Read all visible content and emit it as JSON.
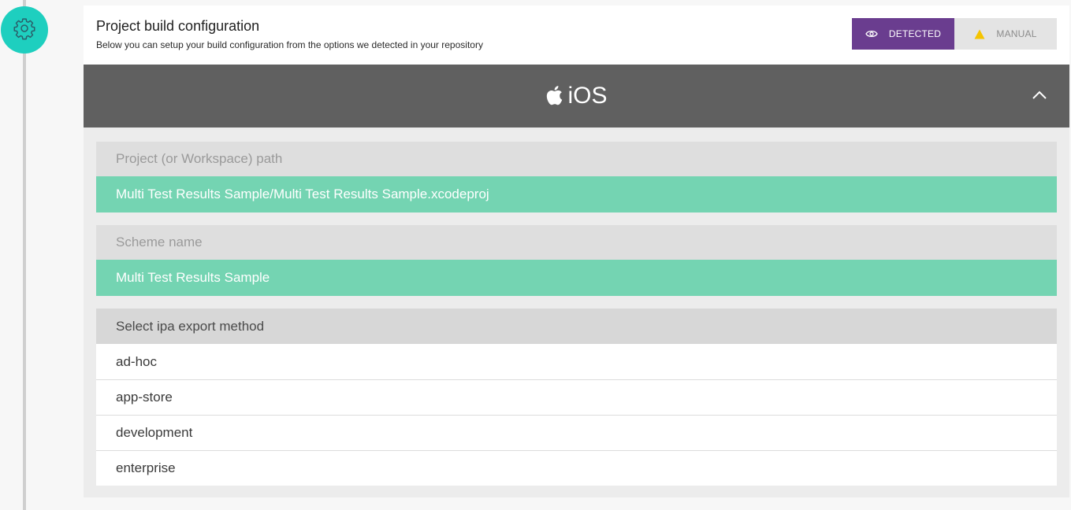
{
  "header": {
    "title": "Project build configuration",
    "subtitle": "Below you can setup your build configuration from the options we detected in your repository"
  },
  "step": {
    "icon": "gear-icon"
  },
  "mode_toggle": {
    "detected_label": "DETECTED",
    "detected_icon": "eye-icon",
    "manual_label": "MANUAL",
    "manual_icon": "warning-icon",
    "active": "DETECTED"
  },
  "platform": {
    "name": "iOS",
    "icon": "apple-icon",
    "collapse_icon": "chevron-up-icon"
  },
  "fields": {
    "project_path": {
      "label": "Project (or Workspace) path",
      "value": "Multi Test Results Sample/Multi Test Results Sample.xcodeproj"
    },
    "scheme": {
      "label": "Scheme name",
      "value": "Multi Test Results Sample"
    }
  },
  "export_method": {
    "label": "Select ipa export method",
    "options": [
      "ad-hoc",
      "app-store",
      "development",
      "enterprise"
    ]
  },
  "colors": {
    "accent_teal": "#1ecfbf",
    "selected_green": "#74d4b2",
    "detected_purple": "#6a3d8f",
    "platform_bar": "#606060",
    "warning_yellow": "#f5c400"
  }
}
